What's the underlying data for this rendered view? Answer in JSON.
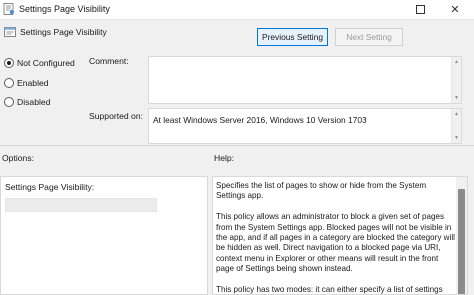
{
  "window": {
    "title": "Settings Page Visibility",
    "controls": {
      "maximize_icon": "maximize-icon",
      "close_label": "✕"
    }
  },
  "header": {
    "title": "Settings Page Visibility",
    "icon": "policy-setting-icon"
  },
  "navigation": {
    "previous_label": "Previous Setting",
    "next_label": "Next Setting",
    "next_enabled": false
  },
  "state": {
    "options": [
      {
        "label": "Not Configured",
        "selected": true
      },
      {
        "label": "Enabled",
        "selected": false
      },
      {
        "label": "Disabled",
        "selected": false
      }
    ]
  },
  "comment": {
    "label": "Comment:",
    "value": ""
  },
  "supported": {
    "label": "Supported on:",
    "value": "At least Windows Server 2016, Windows 10 Version 1703"
  },
  "options_panel": {
    "heading": "Options:",
    "field_label": "Settings Page Visibility:",
    "field_value": ""
  },
  "help_panel": {
    "heading": "Help:",
    "paragraphs": [
      "Specifies the list of pages to show or hide from the System Settings app.",
      "This policy allows an administrator to block a given set of pages from the System Settings app. Blocked pages will not be visible in the app, and if all pages in a category are blocked the category will be hidden as well. Direct navigation to a blocked page via URI, context menu in Explorer or other means will result in the front page of Settings being shown instead.",
      "This policy has two modes: it can either specify a list of settings"
    ]
  },
  "colors": {
    "accent": "#0078d7",
    "background": "#f0f0f0"
  }
}
